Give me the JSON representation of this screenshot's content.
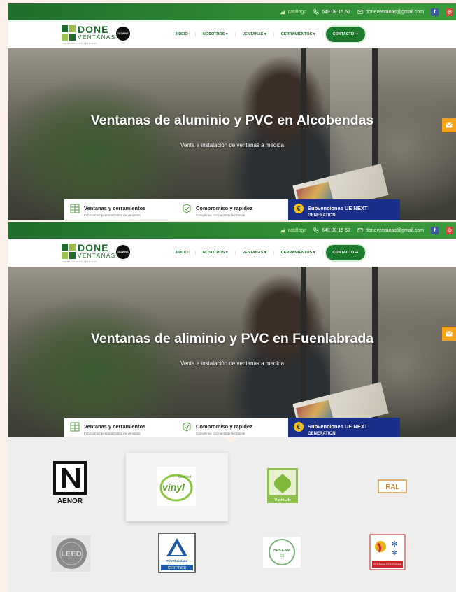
{
  "topbar": {
    "catalogo_label": "catálogo",
    "phone": "649 08 15 52",
    "email": "doneventanas@gmail.com",
    "facebook_icon": "f",
    "instagram_icon": "◎"
  },
  "logo": {
    "word1": "DONE",
    "word2": "VENTANAS",
    "tagline": "CERRAMIENTOS TÉCNICOS",
    "badge": "DOWNS QUALITY"
  },
  "nav": {
    "items": [
      "INICIO",
      "NOSOTROS ▾",
      "VENTANAS ▾",
      "CERRAMIENTOS ▾"
    ],
    "cta": "CONTACTO ➜"
  },
  "hero1": {
    "title": "Ventanas de aluminio y PVC en Alcobendas",
    "subtitle": "Venta e instalación de ventanas a medida"
  },
  "hero2": {
    "title": "Ventanas de aliminio y PVC en Fuenlabrada",
    "subtitle": "Venta e instalación de ventanas a medida"
  },
  "cards": {
    "c1_title": "Ventanas y cerramientos",
    "c1_desc": "Fabricamos personalizados en ventanas",
    "c2_title": "Compromiso y rapidez",
    "c2_desc": "Cumplimos con nuestros fechas de",
    "c3_title": "Subvenciones UE NEXT",
    "c3_desc": "GENERATION"
  },
  "certs": {
    "aenor": "AENOR",
    "vinyl": "vinyl",
    "vinyl_tag": "Certified",
    "verde": "VERDE",
    "ral": "RAL",
    "leed": "LEED",
    "tuv": "TÜVRheinland",
    "tuv_tag": "CERTIFIED",
    "breeam": "BREEAM",
    "breeam_sub": "ES",
    "ventana_sub": "VENTANA CONFORME"
  },
  "colors": {
    "brand_green": "#1e7a2c",
    "topbar_green": "#2f8a35",
    "cta_green": "#1e7a2c",
    "card_blue": "#1a2f8a",
    "mail_orange": "#f3a21a",
    "page_bg": "#fbf1ea",
    "logos_bg": "#eeeeee"
  },
  "icons": [
    "leaf-icon",
    "phone-icon",
    "email-icon",
    "facebook-icon",
    "instagram-icon",
    "mail-icon",
    "window-icon",
    "shield-check-icon",
    "euro-icon"
  ]
}
